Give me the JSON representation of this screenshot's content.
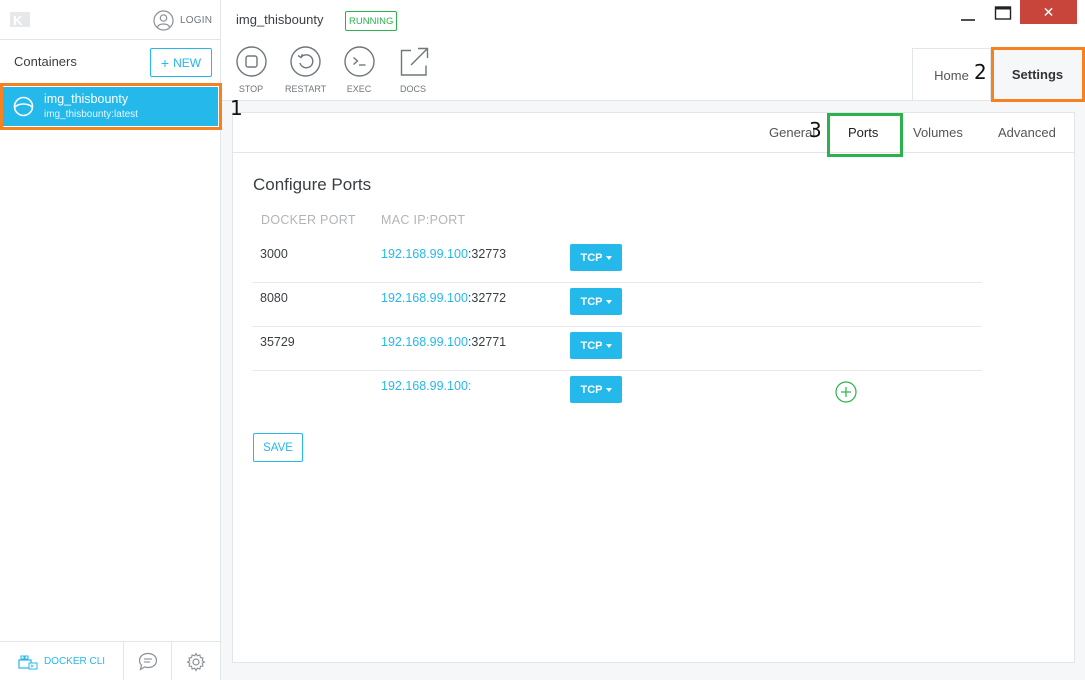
{
  "sidebar": {
    "login_label": "LOGIN",
    "containers_label": "Containers",
    "new_button_label": "NEW",
    "containers": [
      {
        "name": "img_thisbounty",
        "image": "img_thisbounty:latest",
        "selected": true
      }
    ],
    "docker_cli_label": "DOCKER CLI"
  },
  "header": {
    "container_name": "img_thisbounty",
    "status": "RUNNING",
    "actions": [
      {
        "label": "STOP",
        "icon": "stop-icon"
      },
      {
        "label": "RESTART",
        "icon": "restart-icon"
      },
      {
        "label": "EXEC",
        "icon": "terminal-icon"
      },
      {
        "label": "DOCS",
        "icon": "external-link-icon"
      }
    ],
    "tabs": [
      {
        "label": "Home",
        "active": false
      },
      {
        "label": "Settings",
        "active": true
      }
    ]
  },
  "settings": {
    "subtabs": [
      {
        "label": "General",
        "active": false
      },
      {
        "label": "Ports",
        "active": true
      },
      {
        "label": "Volumes",
        "active": false
      },
      {
        "label": "Advanced",
        "active": false
      }
    ],
    "heading": "Configure Ports",
    "columns": {
      "docker_port": "DOCKER PORT",
      "mac_ip_port": "MAC IP:PORT"
    },
    "ports": [
      {
        "docker_port": "3000",
        "ip": "192.168.99.100",
        "host_port": ":32773",
        "protocol": "TCP"
      },
      {
        "docker_port": "8080",
        "ip": "192.168.99.100",
        "host_port": ":32772",
        "protocol": "TCP"
      },
      {
        "docker_port": "35729",
        "ip": "192.168.99.100",
        "host_port": ":32771",
        "protocol": "TCP"
      },
      {
        "docker_port": "",
        "ip": "192.168.99.100",
        "host_port": ":",
        "protocol": "TCP"
      }
    ],
    "save_label": "SAVE"
  },
  "annotations": {
    "first": "1",
    "second": "2",
    "third": "3"
  },
  "colors": {
    "accent": "#24b8eb",
    "running": "#2bb24c",
    "highlight_orange": "#f5821f",
    "highlight_green": "#2bb24c",
    "close": "#c7453a"
  }
}
